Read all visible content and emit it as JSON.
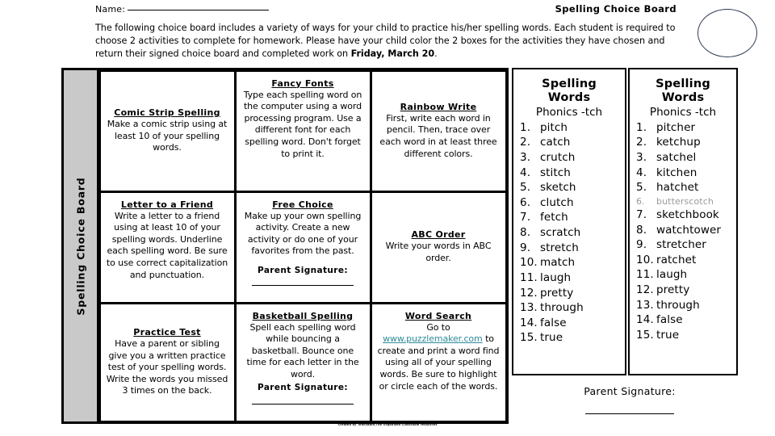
{
  "header": {
    "name_label": "Name:",
    "title": "Spelling Choice Board",
    "intro": "The following choice board includes a variety of ways for your child to practice his/her spelling words. Each student is required to choose 2 activities to complete for homework. Please have your child color the 2 boxes for the activities they have chosen and return their signed choice board and completed work on ",
    "intro_due": "Friday, March 20",
    "intro_end": "."
  },
  "board": {
    "side_label": "Spelling Choice Board",
    "cells": [
      {
        "title": "Comic Strip Spelling",
        "body": "Make a comic strip using at least 10 of your spelling words."
      },
      {
        "title": "Fancy Fonts",
        "body": "Type each spelling word on the computer using a word processing program. Use a different font for each spelling word. Don't forget to print it."
      },
      {
        "title": "Rainbow Write",
        "body": "First, write each word in pencil. Then, trace over each word in at least three different colors."
      },
      {
        "title": "Letter to a Friend",
        "body": "Write a letter to a friend using at least 10 of your spelling words. Underline each spelling word. Be sure to use correct capitalization and punctuation."
      },
      {
        "title": "Free Choice",
        "body": "Make up your own spelling activity. Create a new activity or do one of your favorites from the past.",
        "signature_label": "Parent Signature:"
      },
      {
        "title": "ABC Order",
        "body": "Write your words in ABC order."
      },
      {
        "title": "Practice Test",
        "body": "Have a parent or sibling give you a written practice test of your spelling words. Write the words you missed 3 times on the back."
      },
      {
        "title": "Basketball Spelling",
        "body": "Spell each spelling word while bouncing a basketball. Bounce one time for each letter in the word.",
        "signature_label": "Parent Signature:"
      },
      {
        "title": "Word Search",
        "body_before": "Go to ",
        "link": "www.puzzlemaker.com",
        "body_after": " to create and print a word find using all of your spelling words. Be sure to highlight or circle each of the words."
      }
    ]
  },
  "wordlists": [
    {
      "title": "Spelling Words",
      "subtitle": "Phonics -tch",
      "words": [
        "pitch",
        "catch",
        "crutch",
        "stitch",
        "sketch",
        "clutch",
        "fetch",
        "scratch",
        "stretch",
        "match",
        "laugh",
        "pretty",
        "through",
        "false",
        "true"
      ],
      "faint_index": -1
    },
    {
      "title": "Spelling Words",
      "subtitle": "Phonics -tch",
      "words": [
        "pitcher",
        "ketchup",
        "satchel",
        "kitchen",
        "hatchet",
        "butterscotch",
        "sketchbook",
        "watchtower",
        "stretcher",
        "ratchet",
        "laugh",
        "pretty",
        "through",
        "false",
        "true"
      ],
      "faint_index": 5
    }
  ],
  "parent_signature": {
    "label": "Parent Signature:"
  },
  "footer": {
    "text": "Created by Teachable/The Organized Classroom resources"
  },
  "colors": {
    "link": "#2e8b9b",
    "sidebar_gray": "#c9c9c9",
    "circle_outline": "#2e3b55"
  }
}
